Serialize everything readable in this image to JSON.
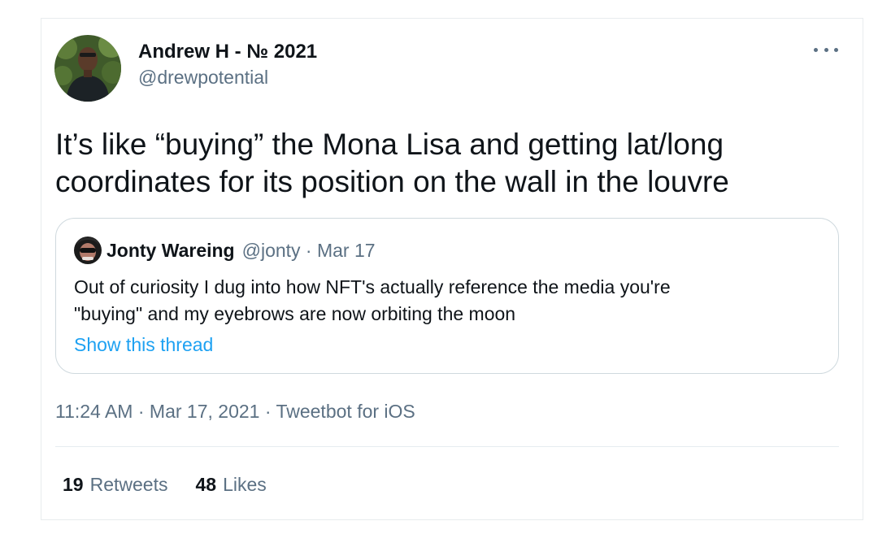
{
  "author": {
    "display_name": "Andrew H - № 2021",
    "handle": "@drewpotential",
    "avatar_icon": "profile-photo"
  },
  "tweet": {
    "text": "It’s like “buying” the Mona Lisa and getting lat/long\ncoordinates for its position on the wall in the louvre"
  },
  "quoted_tweet": {
    "display_name": "Jonty Wareing",
    "handle_date": "@jonty · Mar 17",
    "text": "Out of curiosity I dug into how NFT's actually reference the media you're\n\"buying\" and my eyebrows are now orbiting the moon",
    "show_thread_label": "Show this thread"
  },
  "meta": {
    "timestamp_source": "11:24 AM · Mar 17, 2021 · Tweetbot for iOS"
  },
  "stats": {
    "retweets_count": "19",
    "retweets_label": "Retweets",
    "likes_count": "48",
    "likes_label": "Likes"
  },
  "colors": {
    "text_primary": "#0f1419",
    "text_secondary": "#5b7083",
    "link": "#1da1f2",
    "border": "#cfd9de"
  }
}
